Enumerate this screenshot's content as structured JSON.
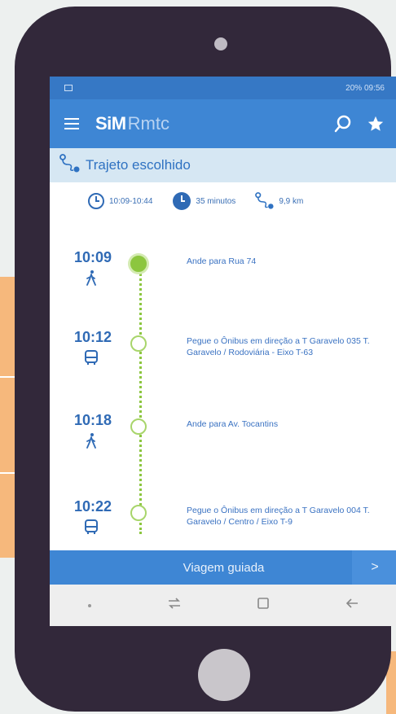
{
  "status_bar": {
    "right_text": "20% 09:56"
  },
  "app": {
    "brand": "SiM",
    "brand_suffix": "Rmtc"
  },
  "route": {
    "header": "Trajeto escolhido",
    "time_range": "10:09-10:44",
    "duration": "35 minutos",
    "distance": "9,9 km"
  },
  "steps": [
    {
      "time": "10:09",
      "mode": "walk-icon",
      "description": "Ande para Rua 74",
      "active": true
    },
    {
      "time": "10:12",
      "mode": "bus-icon",
      "description": "Pegue o Ônibus em direção a T Garavelo 035 T. Garavelo / Rodoviária - Eixo T-63",
      "active": false
    },
    {
      "time": "10:18",
      "mode": "walk-icon",
      "description": "Ande para Av. Tocantins",
      "active": false
    },
    {
      "time": "10:22",
      "mode": "bus-icon",
      "description": "Pegue o Ônibus em direção a T Garavelo 004 T. Garavelo / Centro / Eixo T-9",
      "active": false
    }
  ],
  "footer": {
    "label": "Viagem guiada",
    "next": ">"
  },
  "colors": {
    "primary": "#3e86d4",
    "accent": "#8cc63f",
    "text": "#2f6ab5"
  }
}
